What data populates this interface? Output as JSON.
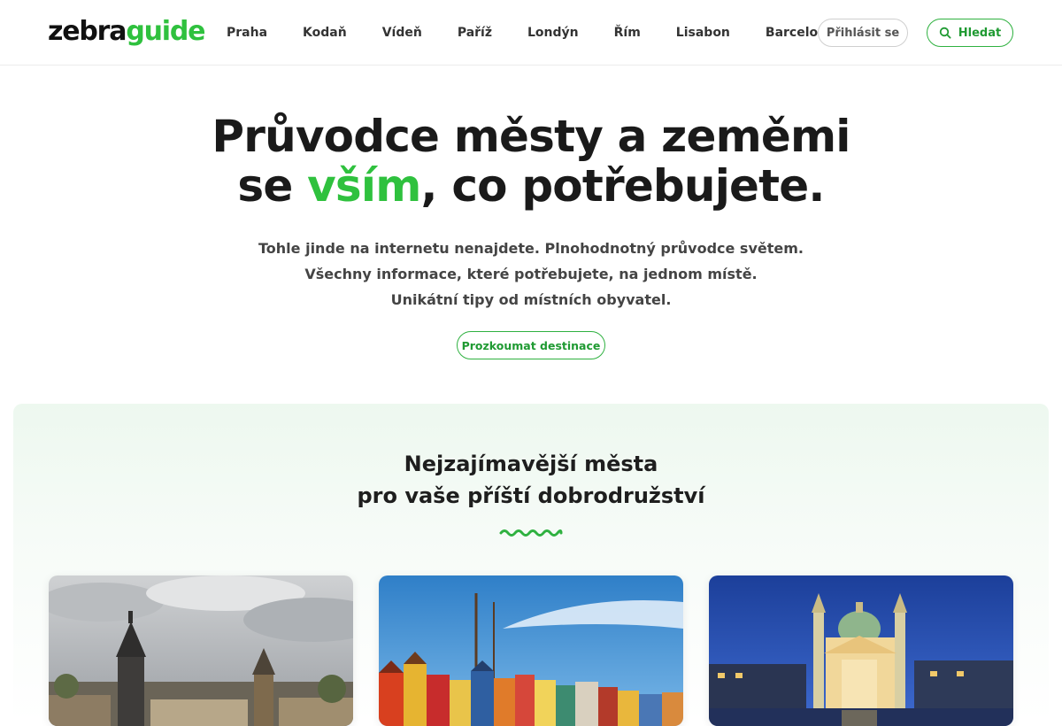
{
  "header": {
    "logo": {
      "part1": "zebra",
      "part2": "guide"
    },
    "nav": [
      "Praha",
      "Kodaň",
      "Vídeň",
      "Paříž",
      "Londýn",
      "Řím",
      "Lisabon",
      "Barcelona"
    ],
    "login_label": "Přihlásit se",
    "search_label": "Hledat",
    "search_icon": "search-icon"
  },
  "hero": {
    "title_line1": "Průvodce městy a zeměmi",
    "title_line2_pre": "se ",
    "title_line2_accent": "vším",
    "title_line2_post": ", co potřebujete.",
    "subtitle": [
      "Tohle jinde na internetu nenajdete. Plnohodnotný průvodce světem.",
      "Všechny informace, které potřebujete, na jednom místě.",
      "Unikátní tipy od místních obyvatel."
    ],
    "cta_label": "Prozkoumat destinace"
  },
  "section": {
    "title_line1": "Nejzajímavější města",
    "title_line2": "pro vaše příští dobrodružství",
    "cards": [
      {
        "image": "prague-bridge-towers-photo"
      },
      {
        "image": "copenhagen-nyhavn-photo"
      },
      {
        "image": "vienna-karlskirche-night-photo"
      }
    ]
  },
  "colors": {
    "brand_green": "#2fc13e",
    "button_green": "#1f9a32",
    "text_dark": "#1a1a1a",
    "section_bg": "#edf8ef"
  }
}
